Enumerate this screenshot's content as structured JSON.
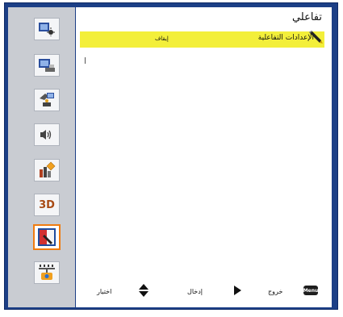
{
  "menu": {
    "title": "تفاعلي",
    "row": {
      "label": "الإعدادات التفاعلية",
      "value": "إيقاف"
    },
    "footer": {
      "select": "اختيار",
      "enter": "إدخال",
      "exit": "خروج",
      "menu_key": "Menu"
    }
  },
  "sidebar": {
    "items": [
      {
        "icon": "image-icon"
      },
      {
        "icon": "display-icon"
      },
      {
        "icon": "setup-icon"
      },
      {
        "icon": "audio-icon"
      },
      {
        "icon": "options-icon"
      },
      {
        "icon": "3d-icon",
        "label": "3D"
      },
      {
        "icon": "interactive-icon",
        "selected": true
      },
      {
        "icon": "network-icon"
      }
    ]
  },
  "colors": {
    "frame": "#1c3f86",
    "highlight": "#f3ef3a",
    "selected_border": "#f07c10",
    "sidebar_bg": "#c9ccd2"
  }
}
